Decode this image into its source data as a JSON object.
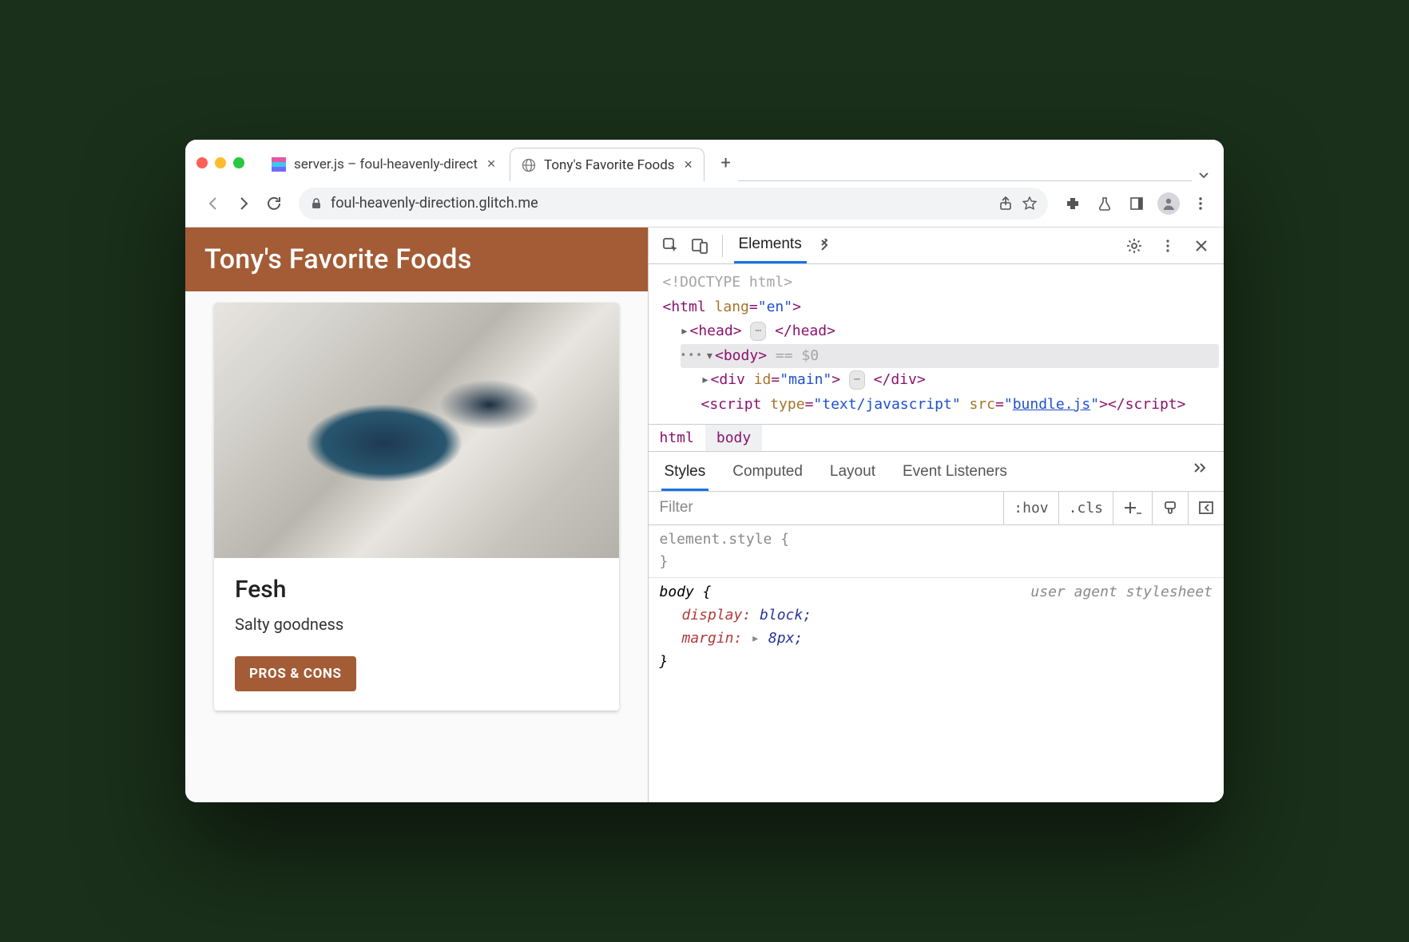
{
  "tabs": [
    {
      "title": "server.js – foul-heavenly-direct"
    },
    {
      "title": "Tony's Favorite Foods"
    }
  ],
  "omnibox": {
    "url": "foul-heavenly-direction.glitch.me"
  },
  "page": {
    "header": "Tony's Favorite Foods",
    "card": {
      "title": "Fesh",
      "text": "Salty goodness",
      "button": "PROS & CONS"
    }
  },
  "devtools": {
    "panel": "Elements",
    "dom": {
      "doctype": "<!DOCTYPE html>",
      "html_open": {
        "tag": "html",
        "attr_name": "lang",
        "attr_val": "\"en\""
      },
      "head": {
        "open": "head",
        "close": "head"
      },
      "body_open": "body",
      "body_sel_suffix": " == $0",
      "div_main": {
        "tag": "div",
        "attr_name": "id",
        "attr_val": "\"main\""
      },
      "script": {
        "tag": "script",
        "attr1_name": "type",
        "attr1_val": "\"text/javascript\"",
        "attr2_name": "src",
        "attr2_val_link": "bundle.js",
        "close": "script"
      }
    },
    "breadcrumb": [
      "html",
      "body"
    ],
    "styles_tabs": [
      "Styles",
      "Computed",
      "Layout",
      "Event Listeners"
    ],
    "filter_placeholder": "Filter",
    "filter_segments": {
      "hov": ":hov",
      "cls": ".cls"
    },
    "rules": {
      "element_style_open": "element.style {",
      "element_style_close": "}",
      "body_open": "body {",
      "body_src": "user agent stylesheet",
      "prop1_name": "display",
      "prop1_val": "block",
      "prop2_name": "margin",
      "prop2_val": "8px",
      "body_close": "}"
    }
  }
}
